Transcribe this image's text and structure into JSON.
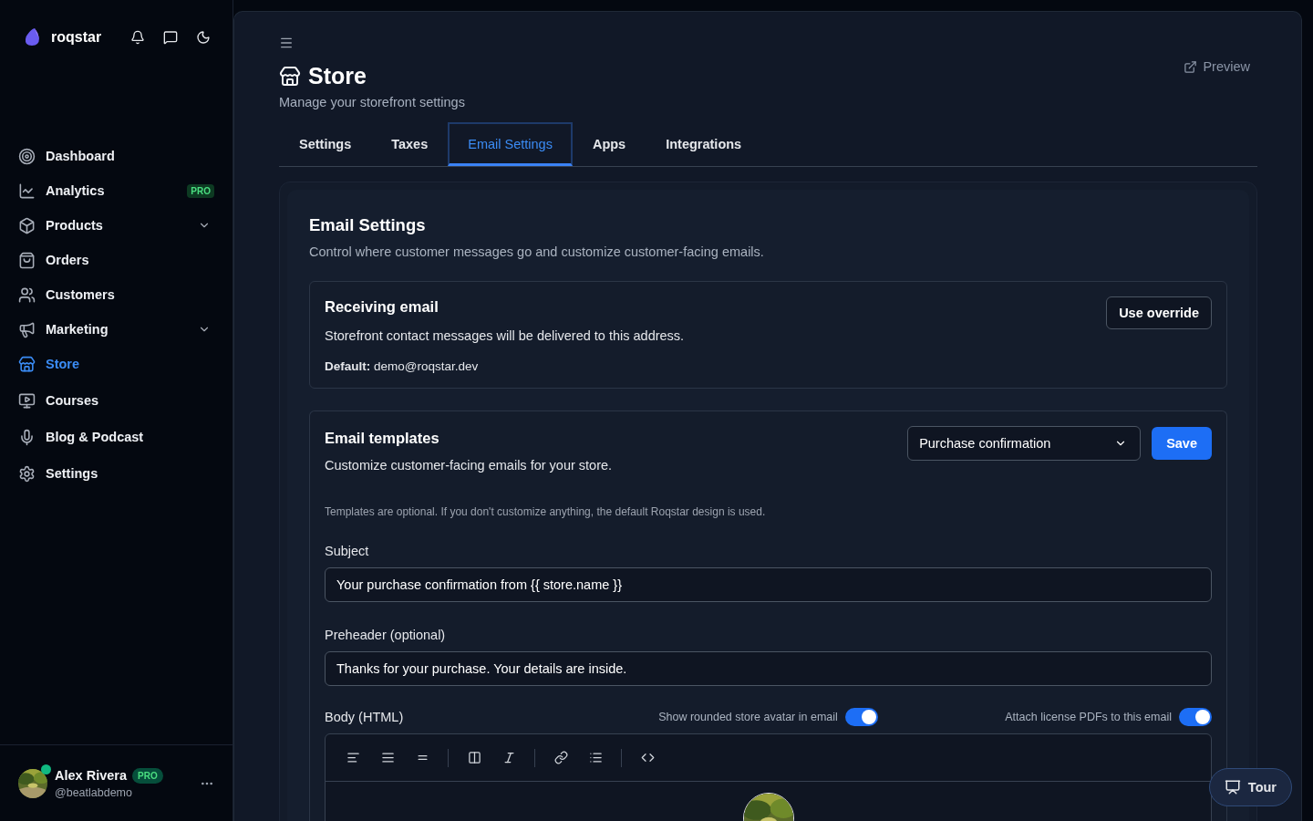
{
  "brand": "roqstar",
  "nav": [
    {
      "label": "Dashboard",
      "selected": false
    },
    {
      "label": "Analytics",
      "selected": false,
      "badge": "PRO"
    },
    {
      "label": "Products",
      "selected": false,
      "expandable": true
    },
    {
      "label": "Orders",
      "selected": false
    },
    {
      "label": "Customers",
      "selected": false
    },
    {
      "label": "Marketing",
      "selected": false,
      "expandable": true
    },
    {
      "label": "Store",
      "selected": true
    },
    {
      "label": "Courses",
      "selected": false
    },
    {
      "label": "Blog & Podcast",
      "selected": false
    },
    {
      "label": "Settings",
      "selected": false
    }
  ],
  "user": {
    "name": "Alex Rivera",
    "badge": "PRO",
    "handle": "@beatlabdemo",
    "online": true
  },
  "page": {
    "title": "Store",
    "subtitle": "Manage your storefront settings",
    "preview": "Preview"
  },
  "tabs": [
    {
      "label": "Settings",
      "selected": false
    },
    {
      "label": "Taxes",
      "selected": false
    },
    {
      "label": "Email Settings",
      "selected": true
    },
    {
      "label": "Apps",
      "selected": false
    },
    {
      "label": "Integrations",
      "selected": false
    }
  ],
  "section": {
    "title": "Email Settings",
    "description": "Control where customer messages go and customize customer-facing emails."
  },
  "receiving": {
    "title": "Receiving email",
    "description": "Storefront contact messages will be delivered to this address.",
    "default_label": "Default:",
    "default_value": "demo@roqstar.dev",
    "button": "Use override"
  },
  "templates": {
    "title": "Email templates",
    "description": "Customize customer-facing emails for your store.",
    "template_select": "Purchase confirmation",
    "save": "Save",
    "note": "Templates are optional. If you don't customize anything, the default Roqstar design is used.",
    "subject_label": "Subject",
    "subject_value": "Your purchase confirmation from {{ store.name }}",
    "preheader_label": "Preheader (optional)",
    "preheader_value": "Thanks for your purchase. Your details are inside.",
    "body_label": "Body (HTML)",
    "toggles": [
      {
        "label": "Show rounded store avatar in email",
        "on": true
      },
      {
        "label": "Attach license PDFs to this email",
        "on": true
      }
    ]
  },
  "tour": "Tour"
}
